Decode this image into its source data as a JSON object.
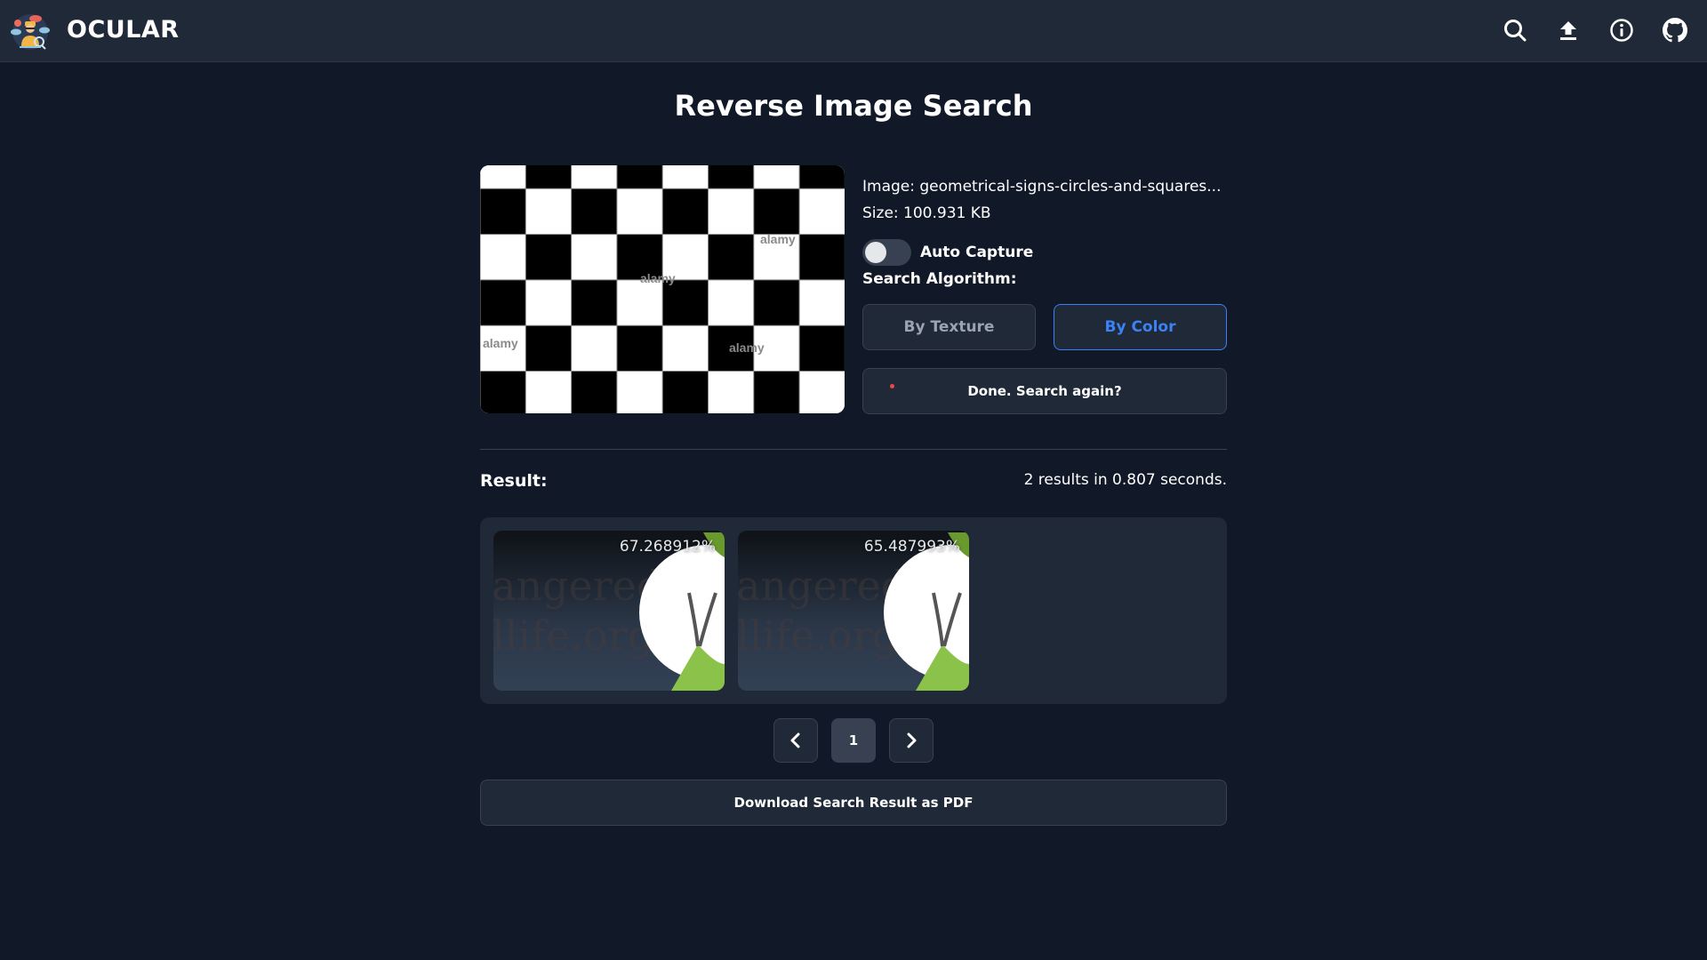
{
  "header": {
    "brand": "OCULAR",
    "icons": [
      "search-icon",
      "upload-icon",
      "info-icon",
      "github-icon"
    ]
  },
  "page": {
    "title": "Reverse Image Search"
  },
  "query": {
    "image_label": "Image: geometrical-signs-circles-and-squares...",
    "size_label": "Size: 100.931 KB",
    "watermark_text": "alamy",
    "auto_capture": {
      "label": "Auto Capture",
      "enabled": false
    },
    "algorithm_label": "Search Algorithm:",
    "algorithms": [
      {
        "label": "By Texture",
        "selected": false
      },
      {
        "label": "By Color",
        "selected": true
      }
    ],
    "search_again_label": "Done. Search again?"
  },
  "results": {
    "label": "Result:",
    "summary": "2 results in 0.807 seconds.",
    "items": [
      {
        "score": "67.268912%",
        "watermark": "angered\nllife.org"
      },
      {
        "score": "65.487993%",
        "watermark": "angered\nllife.org"
      }
    ]
  },
  "pagination": {
    "current_page": "1"
  },
  "download": {
    "label": "Download Search Result as PDF"
  },
  "colors": {
    "background": "#111827",
    "header": "#1f2937",
    "accent": "#3b82f6",
    "status_dot": "#ef4444"
  }
}
